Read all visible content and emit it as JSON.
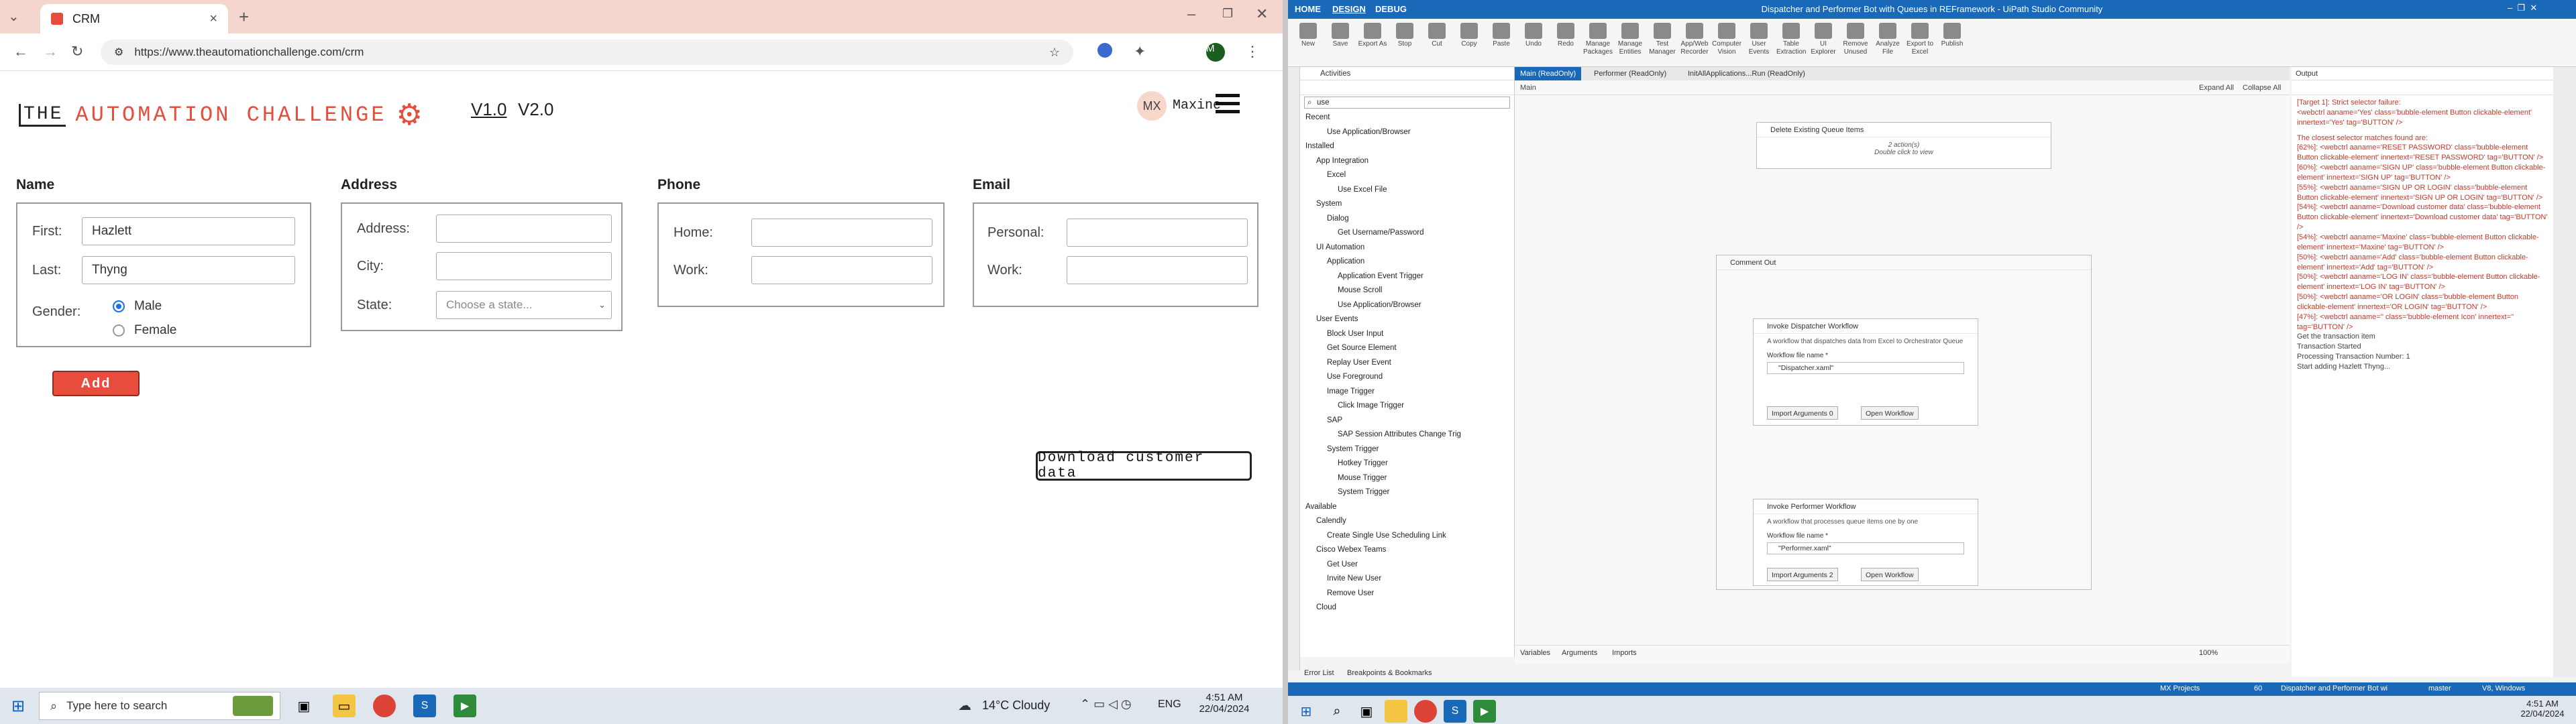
{
  "browser": {
    "tab_title": "CRM",
    "url": "https://www.theautomationchallenge.com/crm",
    "profile_initial": "M"
  },
  "page": {
    "logo_the": "THE",
    "logo_main": "AUTOMATION CHALLENGE",
    "version1": "V1.0",
    "version2": "V2.0",
    "avatar_initials": "MX",
    "username": "Maxine",
    "sections": {
      "name": "Name",
      "address": "Address",
      "phone": "Phone",
      "email": "Email"
    },
    "name_card": {
      "first_label": "First:",
      "first_value": "Hazlett",
      "last_label": "Last:",
      "last_value": "Thyng",
      "gender_label": "Gender:",
      "male": "Male",
      "female": "Female"
    },
    "address_card": {
      "address_label": "Address:",
      "city_label": "City:",
      "state_label": "State:",
      "state_placeholder": "Choose a state..."
    },
    "phone_card": {
      "home_label": "Home:",
      "work_label": "Work:"
    },
    "email_card": {
      "personal_label": "Personal:",
      "work_label": "Work:"
    },
    "add_button": "Add",
    "download_button": "Download customer data"
  },
  "left_taskbar": {
    "search_placeholder": "Type here to search",
    "weather": "14°C  Cloudy",
    "lang": "ENG",
    "time": "4:51 AM",
    "date": "22/04/2024"
  },
  "studio": {
    "title": "Dispatcher and Performer Bot with Queues in REFramework - UiPath Studio Community",
    "menu": [
      "HOME",
      "DESIGN",
      "DEBUG"
    ],
    "ribbon": [
      "New",
      "Save",
      "Export As",
      "Stop",
      "Cut",
      "Copy",
      "Paste",
      "Undo",
      "Redo",
      "Manage Packages",
      "Manage Entities",
      "Test Manager",
      "App/Web Recorder",
      "Computer Vision",
      "User Events",
      "Table Extraction",
      "UI Explorer",
      "Remove Unused",
      "Analyze File",
      "Export to Excel",
      "Publish"
    ],
    "activities_title": "Activities",
    "activities_search": "use",
    "activities": [
      {
        "text": "Recent",
        "indent": 0
      },
      {
        "text": "Use Application/Browser",
        "indent": 2
      },
      {
        "text": "Installed",
        "indent": 0
      },
      {
        "text": "App Integration",
        "indent": 1
      },
      {
        "text": "Excel",
        "indent": 2
      },
      {
        "text": "Use Excel File",
        "indent": 3
      },
      {
        "text": "System",
        "indent": 1
      },
      {
        "text": "Dialog",
        "indent": 2
      },
      {
        "text": "Get Username/Password",
        "indent": 3
      },
      {
        "text": "UI Automation",
        "indent": 1
      },
      {
        "text": "Application",
        "indent": 2
      },
      {
        "text": "Application Event Trigger",
        "indent": 3
      },
      {
        "text": "Mouse Scroll",
        "indent": 3
      },
      {
        "text": "Use Application/Browser",
        "indent": 3
      },
      {
        "text": "User Events",
        "indent": 1
      },
      {
        "text": "Block User Input",
        "indent": 2
      },
      {
        "text": "Get Source Element",
        "indent": 2
      },
      {
        "text": "Replay User Event",
        "indent": 2
      },
      {
        "text": "Use Foreground",
        "indent": 2
      },
      {
        "text": "Image Trigger",
        "indent": 2
      },
      {
        "text": "Click Image Trigger",
        "indent": 3
      },
      {
        "text": "SAP",
        "indent": 2
      },
      {
        "text": "SAP Session Attributes Change Trig",
        "indent": 3
      },
      {
        "text": "System Trigger",
        "indent": 2
      },
      {
        "text": "Hotkey Trigger",
        "indent": 3
      },
      {
        "text": "Mouse Trigger",
        "indent": 3
      },
      {
        "text": "System Trigger",
        "indent": 3
      },
      {
        "text": "Available",
        "indent": 0
      },
      {
        "text": "Calendly",
        "indent": 1
      },
      {
        "text": "Create Single Use Scheduling Link",
        "indent": 2
      },
      {
        "text": "Cisco Webex Teams",
        "indent": 1
      },
      {
        "text": "Get User",
        "indent": 2
      },
      {
        "text": "Invite New User",
        "indent": 2
      },
      {
        "text": "Remove User",
        "indent": 2
      },
      {
        "text": "Cloud",
        "indent": 1
      }
    ],
    "doc_tabs": [
      "Main (ReadOnly)",
      "Performer (ReadOnly)",
      "InitAllApplications...Run (ReadOnly)"
    ],
    "breadcrumb": "Main",
    "expand_all": "Expand All",
    "collapse_all": "Collapse All",
    "delete_queue": {
      "title": "Delete Existing Queue Items",
      "sub1": "2 action(s)",
      "sub2": "Double click to view"
    },
    "comment_out": "Comment Out",
    "dispatcher": {
      "title": "Invoke Dispatcher Workflow",
      "desc": "A workflow that dispatches data from Excel to Orchestrator Queue",
      "file_label": "Workflow file name *",
      "file": "\"Dispatcher.xaml\"",
      "import_args": "Import Arguments",
      "args_count": "0",
      "open": "Open Workflow"
    },
    "performer": {
      "title": "Invoke Performer Workflow",
      "desc": "A workflow that processes queue items one by one",
      "file_label": "Workflow file name *",
      "file": "\"Performer.xaml\"",
      "import_args": "Import Arguments",
      "args_count": "2",
      "open": "Open Workflow"
    },
    "bottom_tabs": [
      "Variables",
      "Arguments",
      "Imports"
    ],
    "zoom": "100%",
    "output_title": "Output",
    "output_lines": [
      "[Target 1]: Strict selector failure:",
      "<webctrl aaname='Yes' class='bubble-element Button clickable-element' innertext='Yes' tag='BUTTON' />",
      "",
      "The closest selector matches found are:",
      "[62%]: <webctrl aaname='RESET PASSWORD' class='bubble-element Button clickable-element' innertext='RESET PASSWORD' tag='BUTTON' />",
      "[60%]: <webctrl aaname='SIGN UP' class='bubble-element Button clickable-element' innertext='SIGN UP' tag='BUTTON' />",
      "[55%]: <webctrl aaname='SIGN UP OR LOGIN' class='bubble-element Button clickable-element' innertext='SIGN UP OR LOGIN' tag='BUTTON' />",
      "[54%]: <webctrl aaname='Download customer data' class='bubble-element Button clickable-element' innertext='Download customer data' tag='BUTTON' />",
      "[54%]: <webctrl aaname='Maxine' class='bubble-element Button clickable-element' innertext='Maxine' tag='BUTTON' />",
      "[50%]: <webctrl aaname='Add' class='bubble-element Button clickable-element' innertext='Add' tag='BUTTON' />",
      "[50%]: <webctrl aaname='LOG IN' class='bubble-element Button clickable-element' innertext='LOG IN' tag='BUTTON' />",
      "[50%]: <webctrl aaname='OR LOGIN' class='bubble-element Button clickable-element' innertext='OR LOGIN' tag='BUTTON' />",
      "[47%]: <webctrl aaname='' class='bubble-element Icon' innertext='' tag='BUTTON' />"
    ],
    "output_info": [
      "Get the transaction item",
      "Transaction Started",
      "Processing Transaction Number: 1",
      "Start adding Hazlett Thyng..."
    ],
    "bottom_left_tabs": [
      "Error List",
      "Breakpoints & Bookmarks"
    ],
    "status_right": [
      "MX Projects",
      "60",
      "Dispatcher and Performer Bot wi",
      "master",
      "V8, Windows"
    ],
    "time": "4:51 AM",
    "date": "22/04/2024"
  },
  "colors": {
    "brand": "#e84c3d",
    "studio_blue": "#1a68b8",
    "output_error": "#c0392b"
  }
}
